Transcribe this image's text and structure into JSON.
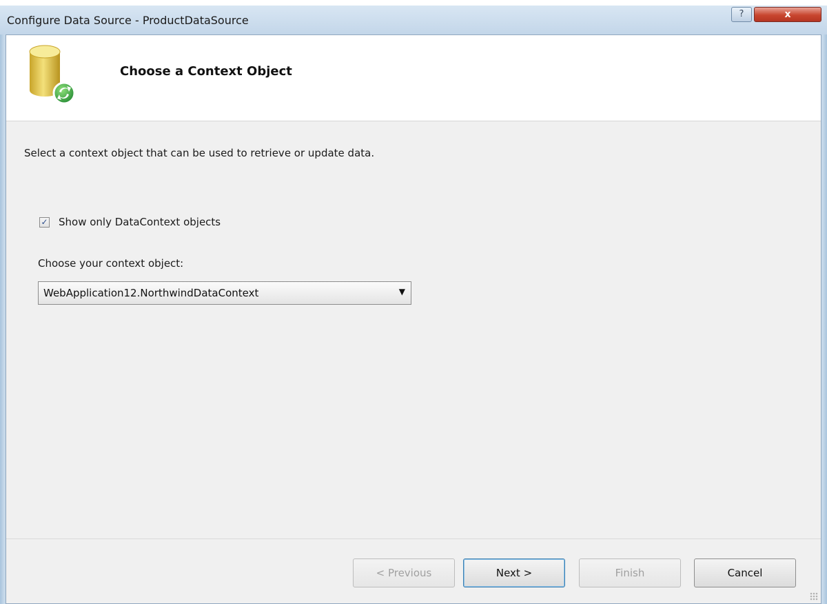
{
  "window": {
    "title": "Configure Data Source - ProductDataSource",
    "help_label": "?",
    "close_label": "x"
  },
  "header": {
    "icon": "database-refresh-icon",
    "heading": "Choose a Context Object"
  },
  "body": {
    "description": "Select a context object that can be used to retrieve or update data.",
    "checkbox": {
      "label": "Show only DataContext objects",
      "checked": true,
      "mark": "✓"
    },
    "context_label": "Choose your context object:",
    "context_select": {
      "value": "WebApplication12.NorthwindDataContext",
      "arrow": "▼"
    }
  },
  "buttons": {
    "previous": "< Previous",
    "next": "Next >",
    "finish": "Finish",
    "cancel": "Cancel"
  },
  "colors": {
    "accent": "#3c7fb1",
    "close": "#c8462f",
    "db_gold": "#e6c84a",
    "db_green": "#3aa34a"
  }
}
